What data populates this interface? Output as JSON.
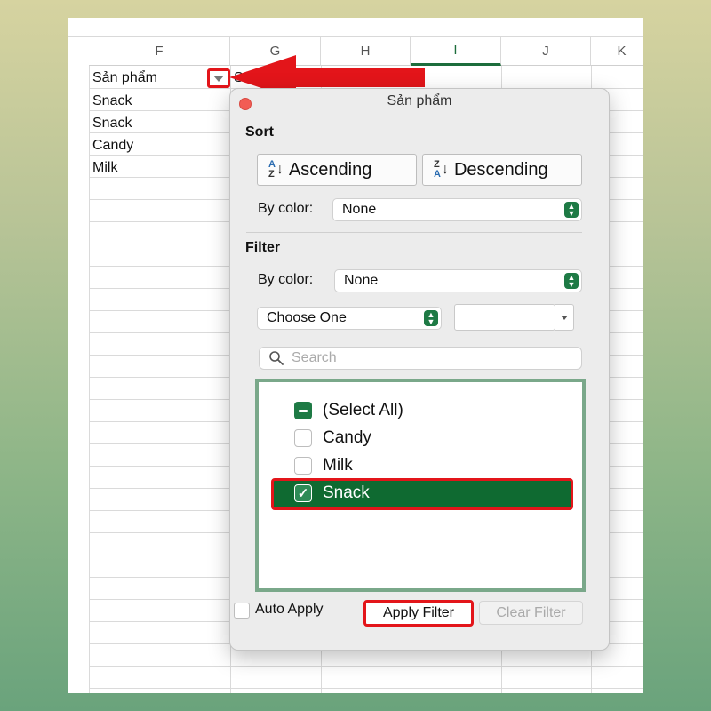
{
  "sheet": {
    "columns": [
      "F",
      "G",
      "H",
      "I",
      "J",
      "K"
    ],
    "active_column": "I",
    "cells": {
      "header": "Sản phẩm",
      "partial_next": "Số",
      "rows": [
        "Snack",
        "Snack",
        "Candy",
        "Milk"
      ]
    },
    "filter_button_icon": "dropdown-triangle-icon",
    "arrow_icon": "red-arrow-icon"
  },
  "dialog": {
    "title": "Sản phẩm",
    "sort": {
      "label": "Sort",
      "ascending": "Ascending",
      "descending": "Descending",
      "ascending_icon": "sort-az-icon",
      "descending_icon": "sort-za-icon",
      "by_color_label": "By color:",
      "by_color_value": "None"
    },
    "filter": {
      "label": "Filter",
      "by_color_label": "By color:",
      "by_color_value": "None",
      "condition_value": "Choose One",
      "condition_text": ""
    },
    "search": {
      "placeholder": "Search",
      "icon": "search-icon"
    },
    "list": [
      {
        "label": "(Select All)",
        "state": "mixed"
      },
      {
        "label": "Candy",
        "state": "unchecked"
      },
      {
        "label": "Milk",
        "state": "unchecked"
      },
      {
        "label": "Snack",
        "state": "checked"
      }
    ],
    "footer": {
      "auto_apply": "Auto Apply",
      "apply": "Apply Filter",
      "clear": "Clear Filter"
    },
    "colors": {
      "accent": "#1e7a45",
      "highlight": "#e3151a",
      "selected_row": "#0f6a31"
    }
  }
}
